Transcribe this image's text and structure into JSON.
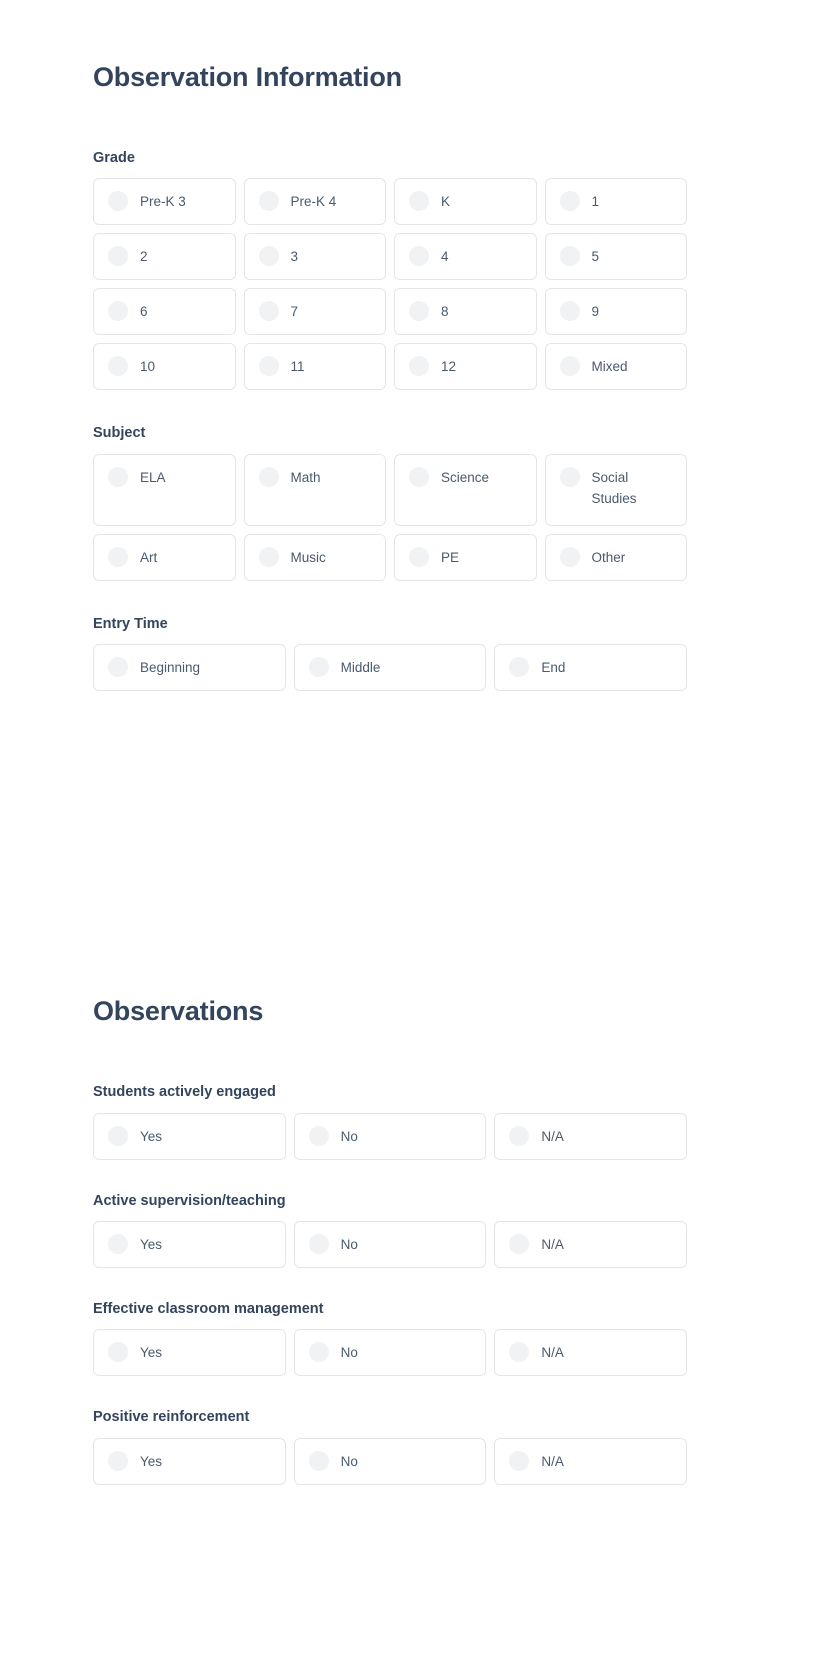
{
  "sections": [
    {
      "id": "observation-information",
      "title": "Observation Information",
      "fields": [
        {
          "id": "grade",
          "label": "Grade",
          "columns": 4,
          "options": [
            "Pre-K 3",
            "Pre-K 4",
            "K",
            "1",
            "2",
            "3",
            "4",
            "5",
            "6",
            "7",
            "8",
            "9",
            "10",
            "11",
            "12",
            "Mixed"
          ]
        },
        {
          "id": "subject",
          "label": "Subject",
          "columns": 4,
          "options": [
            "ELA",
            "Math",
            "Science",
            "Social Studies",
            "Art",
            "Music",
            "PE",
            "Other"
          ]
        },
        {
          "id": "entry-time",
          "label": "Entry Time",
          "columns": 3,
          "options": [
            "Beginning",
            "Middle",
            "End"
          ]
        }
      ]
    },
    {
      "id": "observations",
      "title": "Observations",
      "fields": [
        {
          "id": "students-actively-engaged",
          "label": "Students actively engaged",
          "columns": 3,
          "options": [
            "Yes",
            "No",
            "N/A"
          ]
        },
        {
          "id": "active-supervision-teaching",
          "label": "Active supervision/teaching",
          "columns": 3,
          "options": [
            "Yes",
            "No",
            "N/A"
          ]
        },
        {
          "id": "effective-classroom-management",
          "label": "Effective classroom management",
          "columns": 3,
          "options": [
            "Yes",
            "No",
            "N/A"
          ]
        },
        {
          "id": "positive-reinforcement",
          "label": "Positive reinforcement",
          "columns": 3,
          "options": [
            "Yes",
            "No",
            "N/A"
          ]
        }
      ]
    }
  ],
  "colors": {
    "heading": "#33445c",
    "label_text": "#4a5a6e",
    "card_border": "#e3e6e9",
    "radio_fill": "#f1f2f4",
    "background": "#ffffff"
  },
  "icons": {
    "radio": "radio-unselected-icon"
  }
}
